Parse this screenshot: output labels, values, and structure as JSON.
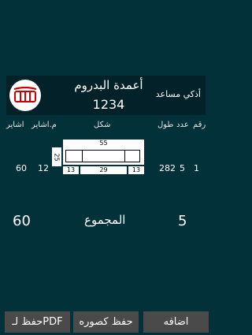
{
  "header": {
    "title": "أعمدة البدروم",
    "code": "1234",
    "assistant": "أذكي مساعد"
  },
  "columns": {
    "number": "رقم",
    "count": "عدد",
    "length": "طول",
    "shape": "شكل",
    "bars": "اشاير",
    "bars_m": "م.اشاير"
  },
  "row": {
    "number": "1",
    "count": "5",
    "length": "282",
    "bars_m": "12",
    "bars": "60",
    "shape": {
      "top": "55",
      "left": "25",
      "bottom_left": "13",
      "bottom_center": "29",
      "bottom_right": "13"
    }
  },
  "summary": {
    "label": "المجموع",
    "left_value": "60",
    "right_value": "5"
  },
  "buttons": {
    "pdf": "حفظ لـPDF",
    "image": "حفظ كصوره",
    "add": "اضافه"
  },
  "logo": {
    "icon": "stairs-jaw-icon"
  }
}
